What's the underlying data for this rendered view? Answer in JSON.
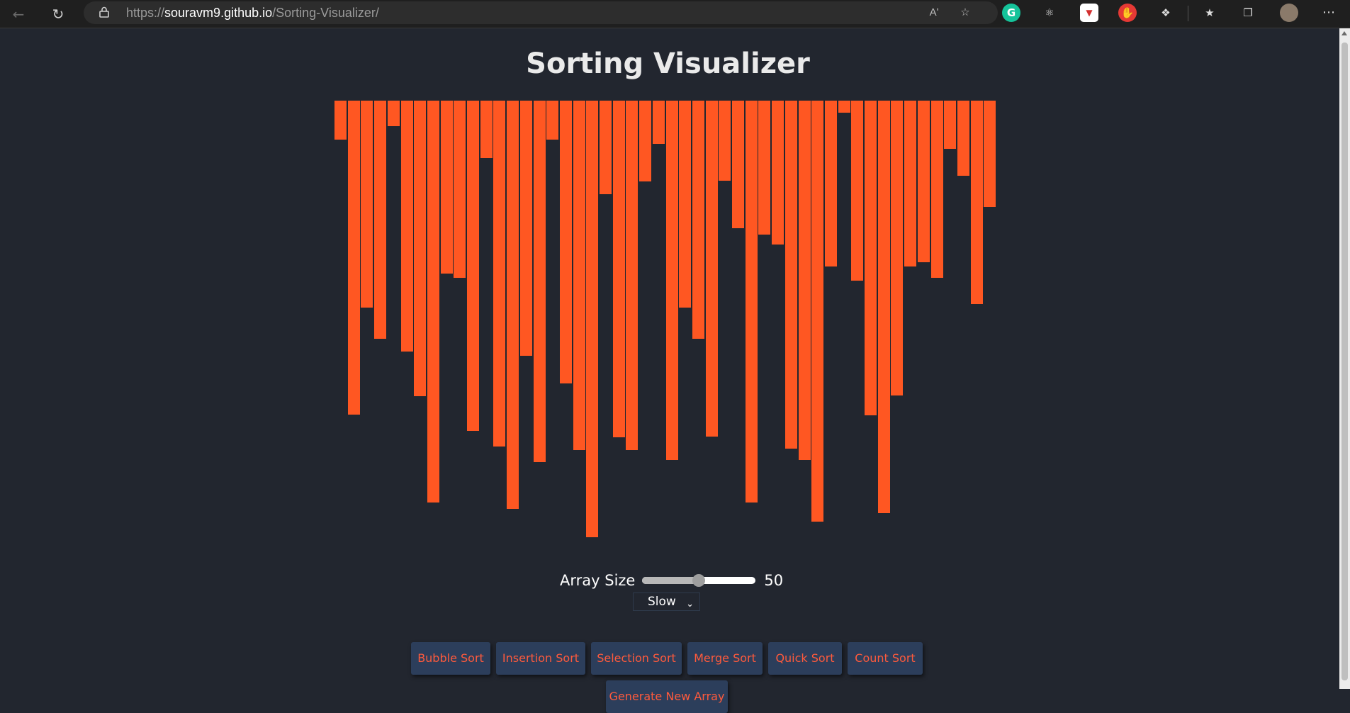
{
  "browser": {
    "url_scheme": "https://",
    "url_host": "souravm9.github.io",
    "url_path": "/Sorting-Visualizer/",
    "read_aloud_label": "Aʹ"
  },
  "page": {
    "title": "Sorting Visualizer",
    "bar_color": "#ff5722",
    "background": "#22262f"
  },
  "chart_data": {
    "type": "bar",
    "orientation": "hanging-from-top",
    "values": [
      55,
      443,
      292,
      336,
      36,
      354,
      417,
      567,
      244,
      250,
      466,
      81,
      488,
      576,
      360,
      510,
      55,
      399,
      493,
      616,
      132,
      475,
      493,
      114,
      61,
      507,
      292,
      336,
      474,
      113,
      180,
      567,
      189,
      203,
      491,
      507,
      594,
      234,
      17,
      254,
      444,
      582,
      416,
      234,
      228,
      250,
      68,
      106,
      287,
      150
    ]
  },
  "controls": {
    "array_size_label": "Array Size",
    "array_size_value": "50",
    "array_size_fraction": 0.5,
    "speed_selected": "Slow",
    "buttons": {
      "bubble": "Bubble Sort",
      "insertion": "Insertion Sort",
      "selection": "Selection Sort",
      "merge": "Merge Sort",
      "quick": "Quick Sort",
      "count": "Count Sort",
      "generate": "Generate New Array"
    },
    "button_bg": "#2c3e5b",
    "button_text_color": "#ff5a3c"
  }
}
